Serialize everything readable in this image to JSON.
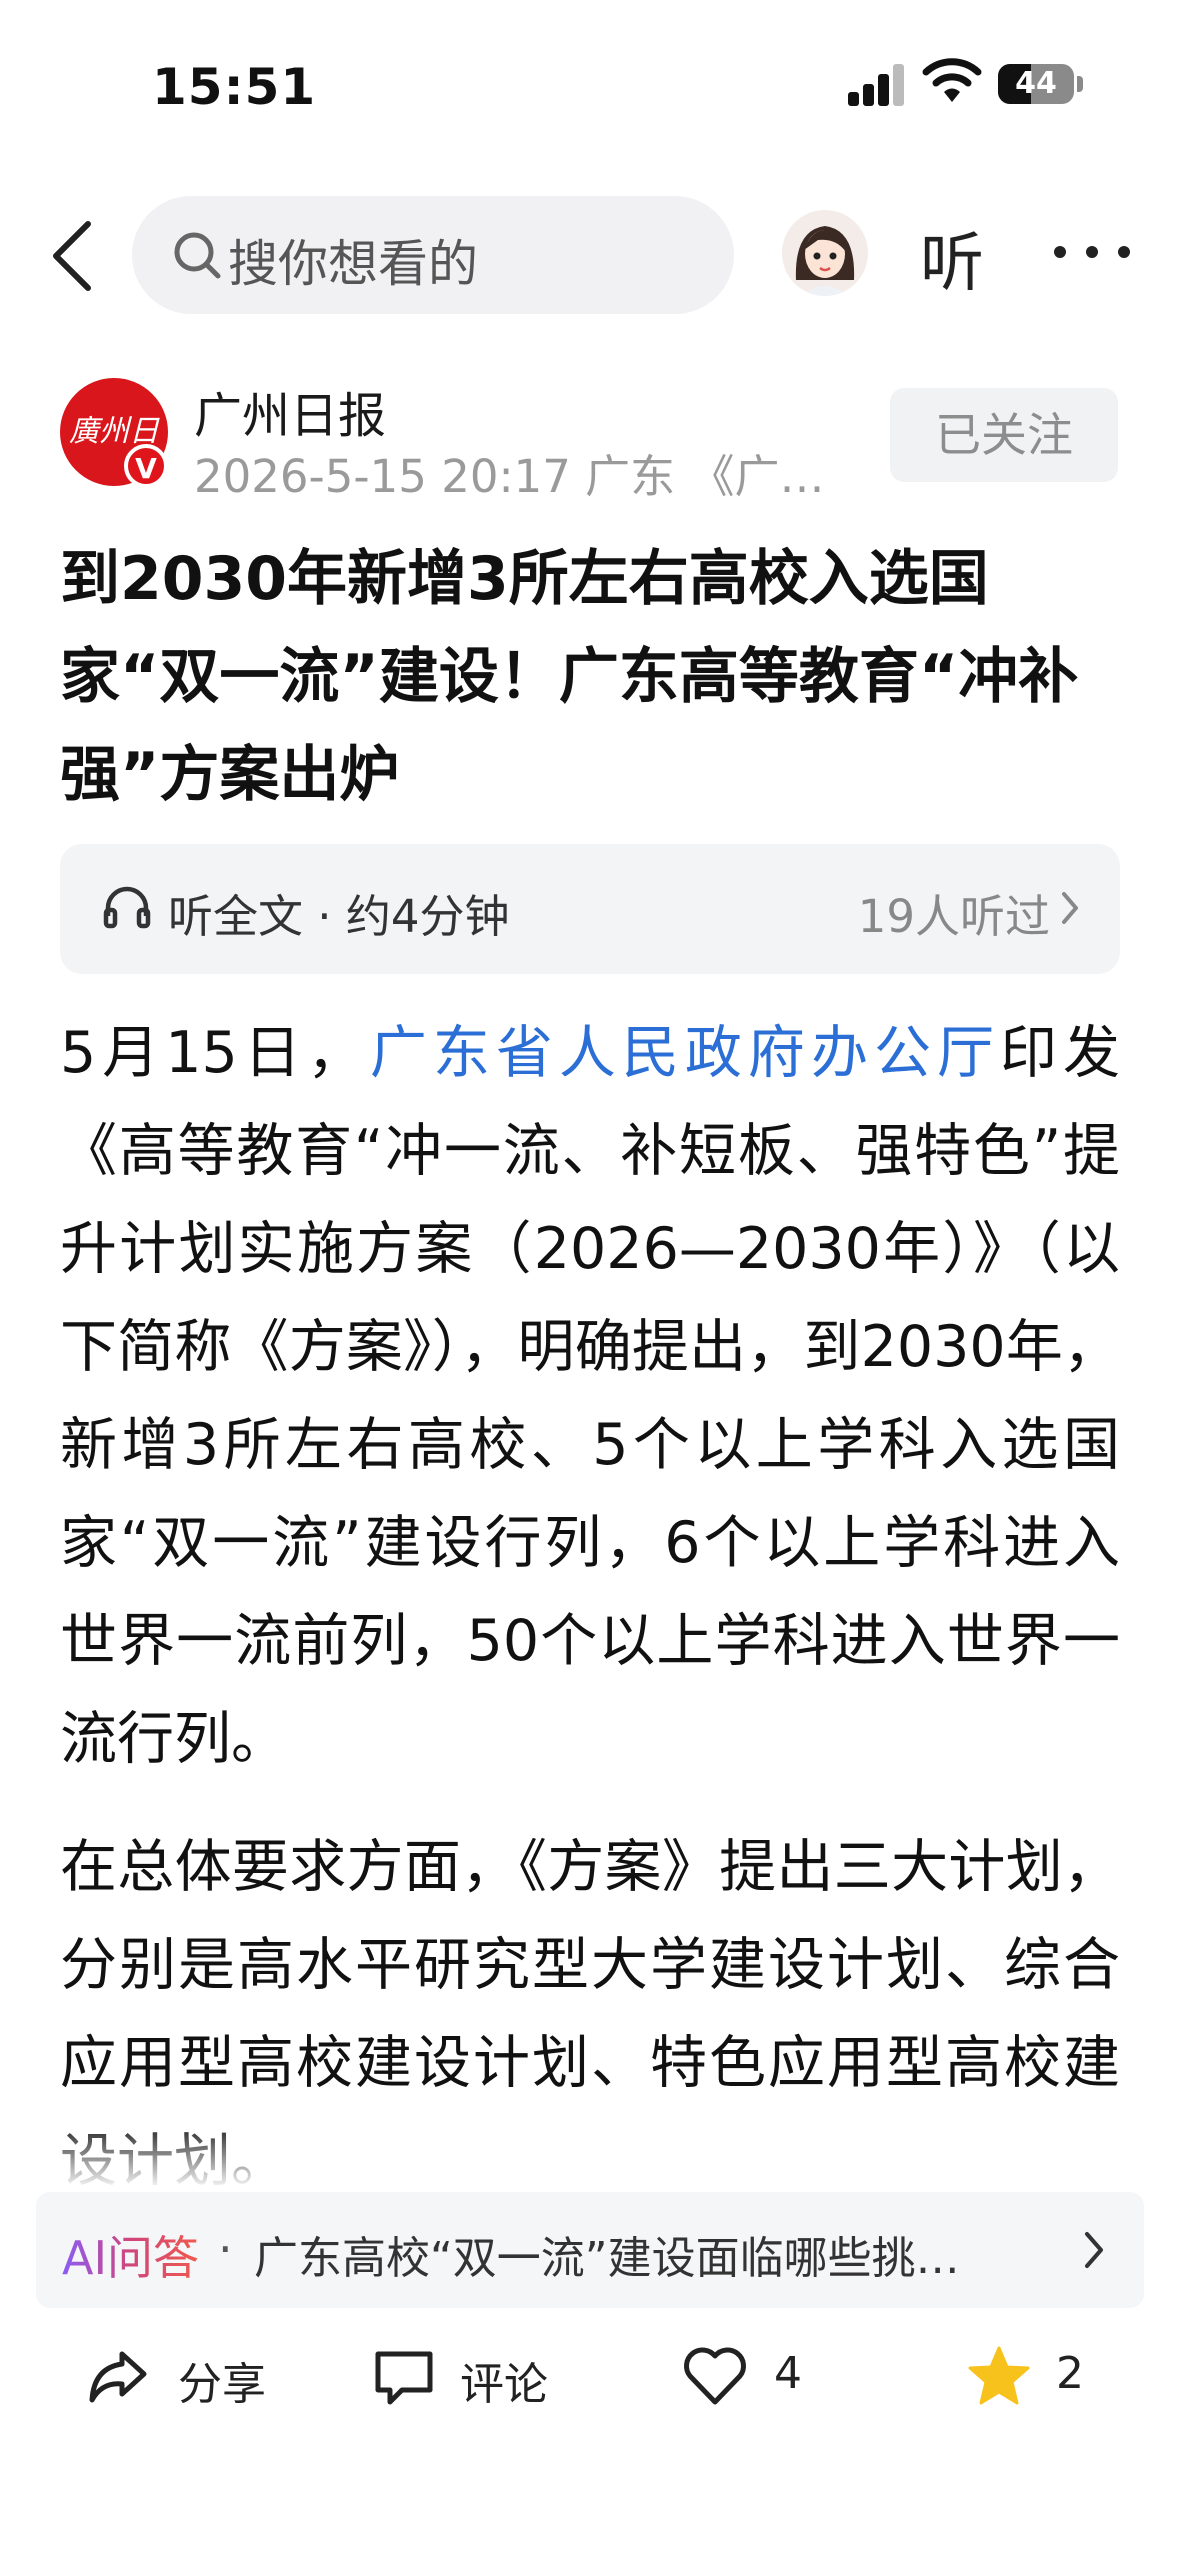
{
  "status_bar": {
    "time": "15:51",
    "battery": "44"
  },
  "nav": {
    "search_placeholder": "搜你想看的",
    "listen_label": "听"
  },
  "author": {
    "logo_text": "廣州日報",
    "badge": "V",
    "name": "广州日报",
    "meta": "2026-5-15  20:17  广东  《广…",
    "follow_label": "已关注"
  },
  "article": {
    "title": "到2030年新增3所左右高校入选国家“双一流”建设！广东高等教育“冲补强”方案出炉",
    "listen_bar": {
      "label": "听全文 · 约4分钟",
      "count": "19人听过"
    },
    "p1_before": "5月15日，",
    "p1_link": "广东省人民政府办公厅",
    "p1_after": "印发《高等教育“冲一流、补短板、强特色”提升计划实施方案（2026—2030年）》（以下简称《方案》），明确提出，到2030年，新增3所左右高校、5个以上学科入选国家“双一流”建设行列，6个以上学科进入世界一流前列，50个以上学科进入世界一流行列。",
    "p2": "在总体要求方面，《方案》提出三大计划，分别是高水平研究型大学建设计划、综合应用型高校建设计划、特色应用型高校建设计划。"
  },
  "ai_qa": {
    "label": "AI问答",
    "separator": "·",
    "question": "广东高校“双一流”建设面临哪些挑…"
  },
  "actions": {
    "share": "分享",
    "comment": "评论",
    "likes": "4",
    "favorites": "2"
  },
  "colors": {
    "link": "#2b6fd6",
    "accent_red": "#d8161b",
    "star": "#f7c21b"
  }
}
